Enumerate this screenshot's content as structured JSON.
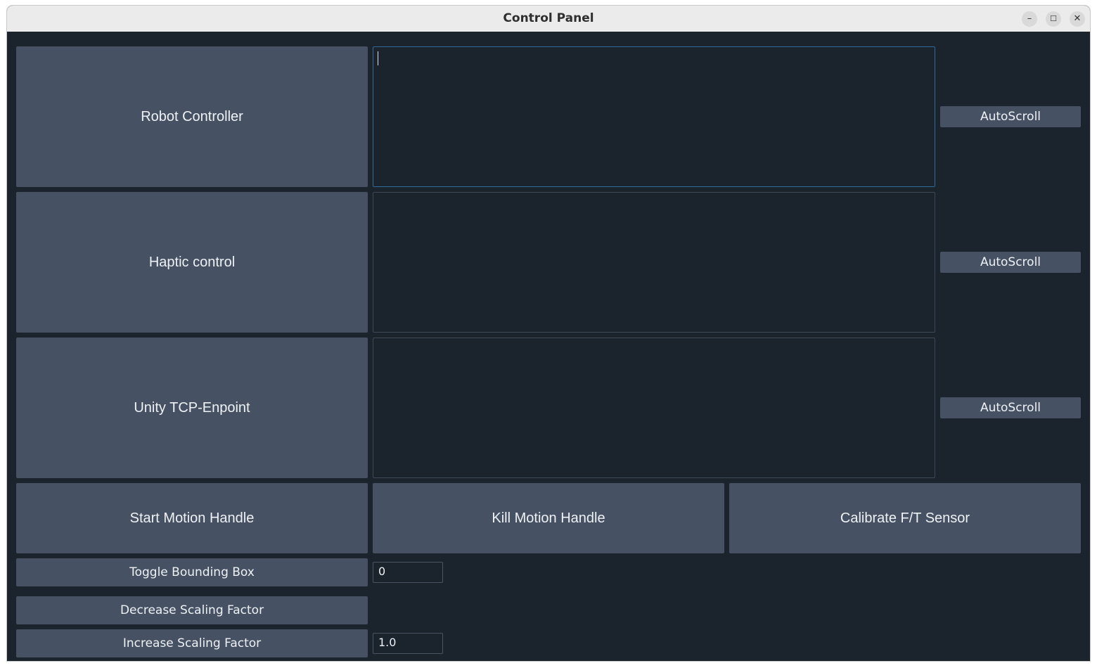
{
  "window": {
    "title": "Control Panel",
    "controls": {
      "minimize": "–",
      "maximize": "☐",
      "close": "✕"
    }
  },
  "panels": [
    {
      "label": "Robot Controller",
      "log_text": "",
      "autoscroll_label": "AutoScroll",
      "focused": true
    },
    {
      "label": "Haptic control",
      "log_text": "",
      "autoscroll_label": "AutoScroll",
      "focused": false
    },
    {
      "label": "Unity TCP-Enpoint",
      "log_text": "",
      "autoscroll_label": "AutoScroll",
      "focused": false
    }
  ],
  "actions": {
    "start_motion": "Start Motion Handle",
    "kill_motion": "Kill Motion Handle",
    "calibrate": "Calibrate F/T Sensor"
  },
  "controls": {
    "toggle_bbox_label": "Toggle Bounding Box",
    "bbox_value": "0",
    "decrease_scaling_label": "Decrease Scaling Factor",
    "increase_scaling_label": "Increase Scaling Factor",
    "scaling_value": "1.0"
  },
  "colors": {
    "background": "#1b232d",
    "button": "#465263",
    "focus_border": "#2f6a9a"
  }
}
